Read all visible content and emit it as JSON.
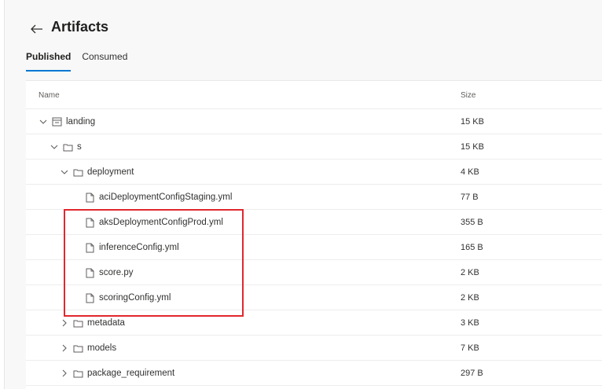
{
  "header": {
    "title": "Artifacts",
    "tabs": [
      {
        "label": "Published",
        "active": true
      },
      {
        "label": "Consumed",
        "active": false
      }
    ]
  },
  "table": {
    "columns": {
      "name": "Name",
      "size": "Size"
    },
    "rows": [
      {
        "name": "landing",
        "size": "15 KB",
        "type": "artifact",
        "expanded": true,
        "depth": 0
      },
      {
        "name": "s",
        "size": "15 KB",
        "type": "folder",
        "expanded": true,
        "depth": 1
      },
      {
        "name": "deployment",
        "size": "4 KB",
        "type": "folder",
        "expanded": true,
        "depth": 2
      },
      {
        "name": "aciDeploymentConfigStaging.yml",
        "size": "77 B",
        "type": "file",
        "depth": 3
      },
      {
        "name": "aksDeploymentConfigProd.yml",
        "size": "355 B",
        "type": "file",
        "depth": 3
      },
      {
        "name": "inferenceConfig.yml",
        "size": "165 B",
        "type": "file",
        "depth": 3
      },
      {
        "name": "score.py",
        "size": "2 KB",
        "type": "file",
        "depth": 3
      },
      {
        "name": "scoringConfig.yml",
        "size": "2 KB",
        "type": "file",
        "depth": 3
      },
      {
        "name": "metadata",
        "size": "3 KB",
        "type": "folder",
        "expanded": false,
        "depth": 2
      },
      {
        "name": "models",
        "size": "7 KB",
        "type": "folder",
        "expanded": false,
        "depth": 2
      },
      {
        "name": "package_requirement",
        "size": "297 B",
        "type": "folder",
        "expanded": false,
        "depth": 2
      }
    ]
  },
  "colors": {
    "accent": "#0078d4",
    "highlight": "#e0282f"
  }
}
